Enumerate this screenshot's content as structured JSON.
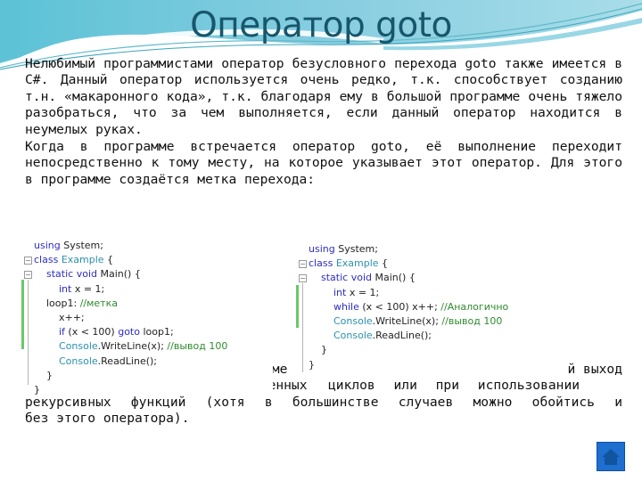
{
  "slide": {
    "title": "Оператор goto",
    "paragraphs": [
      "Нелюбимый программистами оператор безусловного перехода goto также имеется в C#. Данный оператор используется очень редко, т.к. способствует созданию т.н. «макаронного кода», т.к. благодаря ему в большой программе очень тяжело разобраться, что за чем выполняется, если данный оператор находится в неумелых руках.",
      "Когда в программе встречается оператор goto, её выполнение переходит непосредственно к тому месту, на которое указывает этот оператор. Для этого в программе создаётся метка перехода:",
      "… ий выход … оженных циклов или при использовании рекурсивных функций (хотя в большинстве случаев можно обойтись и без этого оператора)."
    ],
    "partially_hidden_fragments": [
      "име",
      "й выход",
      "оженных"
    ],
    "code_left": [
      [
        [
          "kw",
          "using"
        ],
        [
          "",
          " System;"
        ]
      ],
      [
        [
          "kw",
          "class"
        ],
        [
          "",
          " "
        ],
        [
          "ty",
          "Example"
        ],
        [
          "",
          " {"
        ]
      ],
      [
        [
          "",
          "    "
        ],
        [
          "kw",
          "static"
        ],
        [
          "",
          " "
        ],
        [
          "kw",
          "void"
        ],
        [
          "",
          " Main() {"
        ]
      ],
      [
        [
          "",
          "        "
        ],
        [
          "kw",
          "int"
        ],
        [
          "",
          " x = 1;"
        ]
      ],
      [
        [
          "",
          "    loop1: "
        ],
        [
          "cm",
          "//метка"
        ]
      ],
      [
        [
          "",
          "        x++;"
        ]
      ],
      [
        [
          "",
          "        "
        ],
        [
          "kw",
          "if"
        ],
        [
          "",
          " (x < 100) "
        ],
        [
          "kw",
          "goto"
        ],
        [
          "",
          " loop1;"
        ]
      ],
      [
        [
          "",
          "        "
        ],
        [
          "ty",
          "Console"
        ],
        [
          "",
          ".WriteLine(x); "
        ],
        [
          "cm",
          "//вывод 100"
        ]
      ],
      [
        [
          "",
          "        "
        ],
        [
          "ty",
          "Console"
        ],
        [
          "",
          ".ReadLine();"
        ]
      ],
      [
        [
          "",
          "    }"
        ]
      ],
      [
        [
          "",
          "}"
        ]
      ]
    ],
    "code_right": [
      [
        [
          "kw",
          "using"
        ],
        [
          "",
          " System;"
        ]
      ],
      [
        [
          "kw",
          "class"
        ],
        [
          "",
          " "
        ],
        [
          "ty",
          "Example"
        ],
        [
          "",
          " {"
        ]
      ],
      [
        [
          "",
          "    "
        ],
        [
          "kw",
          "static"
        ],
        [
          "",
          " "
        ],
        [
          "kw",
          "void"
        ],
        [
          "",
          " Main() {"
        ]
      ],
      [
        [
          "",
          "        "
        ],
        [
          "kw",
          "int"
        ],
        [
          "",
          " x = 1;"
        ]
      ],
      [
        [
          "",
          "        "
        ],
        [
          "kw",
          "while"
        ],
        [
          "",
          " (x < 100) x++; "
        ],
        [
          "cm",
          "//Аналогично"
        ]
      ],
      [
        [
          "",
          "        "
        ],
        [
          "ty",
          "Console"
        ],
        [
          "",
          ".WriteLine(x); "
        ],
        [
          "cm",
          "//вывод 100"
        ]
      ],
      [
        [
          "",
          "        "
        ],
        [
          "ty",
          "Console"
        ],
        [
          "",
          ".ReadLine();"
        ]
      ],
      [
        [
          "",
          "    }"
        ]
      ],
      [
        [
          "",
          "}"
        ]
      ]
    ],
    "home_button": {
      "icon": "home-icon",
      "color": "#1f6fd1"
    }
  }
}
